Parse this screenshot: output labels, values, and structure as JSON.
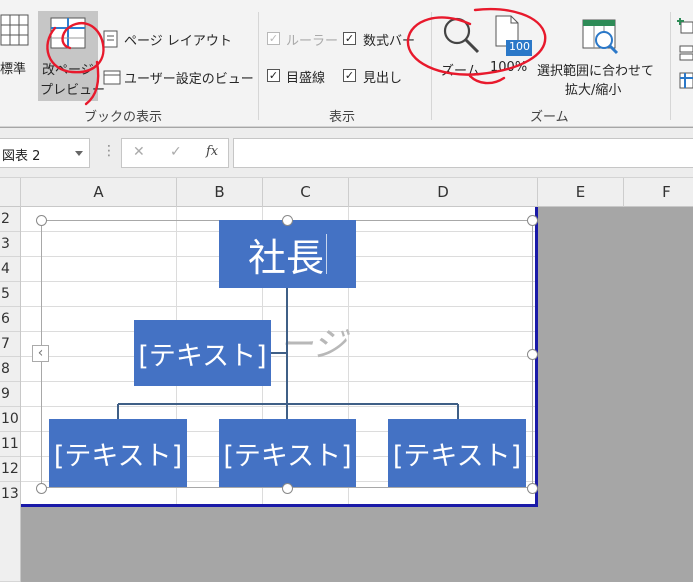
{
  "ribbon": {
    "standard_label": "標準",
    "page_break_preview_line1": "改ページ",
    "page_break_preview_line2": "プレビュー",
    "page_layout_label": "ページ レイアウト",
    "custom_view_label": "ユーザー設定のビュー",
    "group_book_view": "ブックの表示",
    "ruler_label": "ルーラー",
    "formula_bar_label": "数式バー",
    "gridlines_label": "目盛線",
    "headings_label": "見出し",
    "group_show": "表示",
    "zoom_label": "ズーム",
    "zoom100_label": "100%",
    "zoom100_badge": "100",
    "zoom_selection_line1": "選択範囲に合わせて",
    "zoom_selection_line2": "拡大/縮小",
    "group_zoom": "ズーム",
    "checks": {
      "ruler": true,
      "formula_bar": true,
      "gridlines": true,
      "headings": true
    }
  },
  "formula_bar": {
    "name_box": "図表 2",
    "cancel_glyph": "✕",
    "enter_glyph": "✓",
    "fx_label": "fx",
    "more_glyph": "⋮",
    "value": ""
  },
  "columns": [
    "A",
    "B",
    "C",
    "D",
    "E",
    "F"
  ],
  "rows": [
    "2",
    "3",
    "4",
    "5",
    "6",
    "7",
    "8",
    "9",
    "10",
    "11",
    "12",
    "13"
  ],
  "smartart": {
    "top_box": "社長",
    "assistant_box": "[テキスト]",
    "bottom_boxes": [
      "[テキスト]",
      "[テキスト]",
      "[テキスト]"
    ],
    "watermark": "ージ",
    "expand_glyph": "‹"
  },
  "colors": {
    "accent": "#4472c4",
    "annotation": "#e8192c",
    "page_border": "#1a1aa8"
  }
}
